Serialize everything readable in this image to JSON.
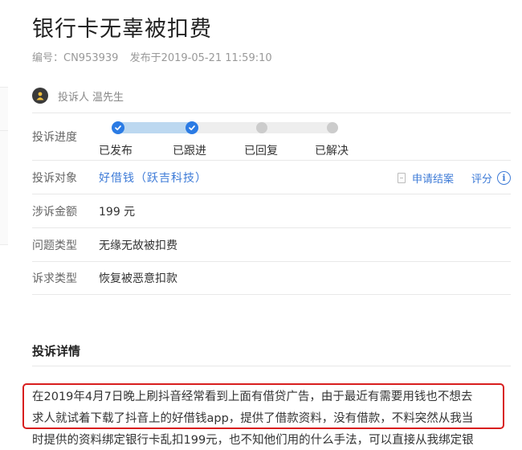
{
  "complaint": {
    "title": "银行卡无辜被扣费",
    "id_text": "编号：CN953939",
    "published_text": "发布于2019-05-21 11:59:10",
    "complainant_label": "投诉人",
    "complainant_name": "温先生"
  },
  "info": {
    "progress_label": "投诉进度",
    "steps": [
      {
        "label": "已发布",
        "done": true
      },
      {
        "label": "已跟进",
        "done": true
      },
      {
        "label": "已回复",
        "done": false
      },
      {
        "label": "已解决",
        "done": false
      }
    ],
    "target_label": "投诉对象",
    "target_value": "好借钱（跃吉科技）",
    "apply_close": "申请结案",
    "rate": "评分",
    "amount_label": "涉诉金额",
    "amount_value": "199 元",
    "issue_label": "问题类型",
    "issue_value": "无缘无故被扣费",
    "demand_label": "诉求类型",
    "demand_value": "恢复被恶意扣款"
  },
  "details": {
    "title": "投诉详情",
    "lines": [
      "在2019年4月7日晚上刷抖音经常看到上面有借贷广告，由于最近有需要用钱也不想去",
      "求人就试着下载了抖音上的好借钱app，提供了借款资料，没有借款，不料突然从我当",
      "时提供的资料绑定银行卡乱扣199元，也不知他们用的什么手法，可以直接从我绑定银"
    ]
  },
  "colors": {
    "accent": "#3e7bd7",
    "step_done": "#2b7be4",
    "step_todo": "#cccccc",
    "highlight": "#d81e1e"
  },
  "icons": {
    "avatar": "user-avatar-icon",
    "step_done": "checkmark-icon",
    "apply_close": "document-icon",
    "info": "info-circle-icon"
  }
}
